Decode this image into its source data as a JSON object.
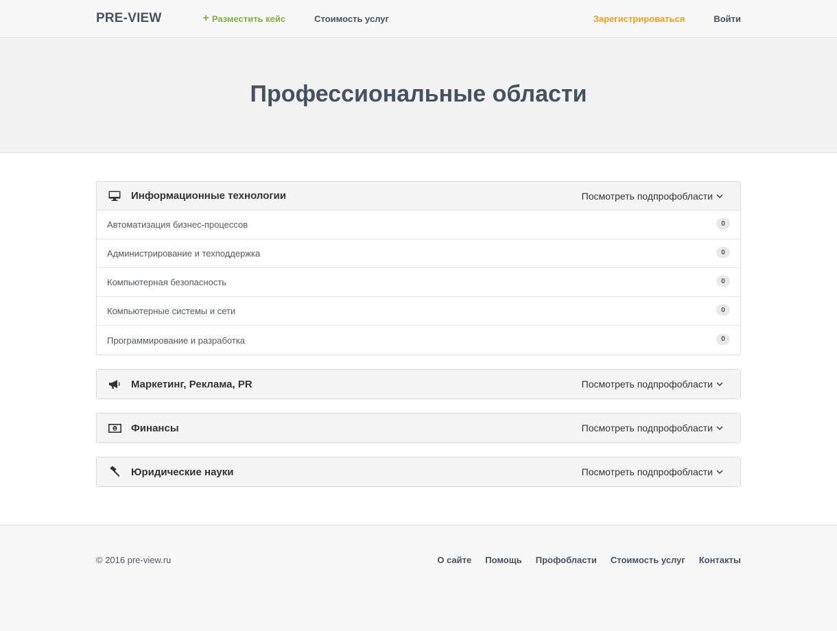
{
  "header": {
    "brand": "PRE-VIEW",
    "add_case": "Разместить кейс",
    "pricing": "Стоимость услуг",
    "register": "Зарегистрироваться",
    "login": "Войти"
  },
  "hero": {
    "title": "Профессиональные области"
  },
  "panels": [
    {
      "title": "Информационные технологии",
      "icon": "monitor-icon",
      "toggle": "Посмотреть подпрофобласти",
      "open": true,
      "items": [
        {
          "label": "Автоматизация бизнес-процессов",
          "count": "0"
        },
        {
          "label": "Администрирование и техподдержка",
          "count": "0"
        },
        {
          "label": "Компьютерная безопасность",
          "count": "0"
        },
        {
          "label": "Компьютерные системы и сети",
          "count": "0"
        },
        {
          "label": "Программирование и разработка",
          "count": "0"
        }
      ]
    },
    {
      "title": "Маркетинг, Реклама, PR",
      "icon": "megaphone-icon",
      "toggle": "Посмотреть подпрофобласти",
      "open": false
    },
    {
      "title": "Финансы",
      "icon": "money-icon",
      "toggle": "Посмотреть подпрофобласти",
      "open": false
    },
    {
      "title": "Юридические науки",
      "icon": "gavel-icon",
      "toggle": "Посмотреть подпрофобласти",
      "open": false
    }
  ],
  "footer": {
    "copyright": "© 2016 pre-view.ru",
    "links": [
      "О сайте",
      "Помощь",
      "Профобласти",
      "Стоимость услуг",
      "Контакты"
    ]
  },
  "colors": {
    "accent_green": "#7cb342",
    "accent_orange": "#f39c1f",
    "text_dark": "#45525f"
  }
}
